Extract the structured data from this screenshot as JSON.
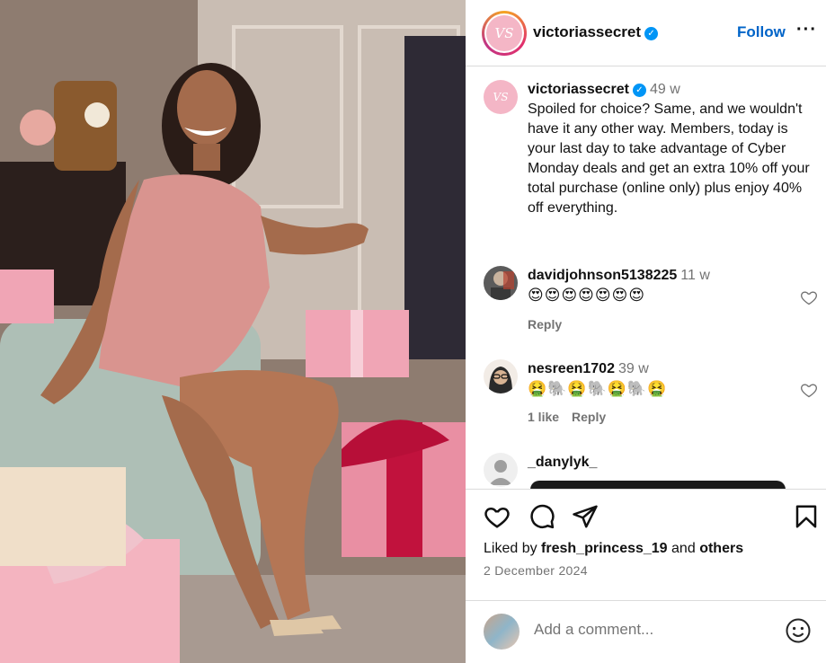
{
  "header": {
    "username": "victoriassecret",
    "follow_label": "Follow",
    "more_label": "···",
    "logo_text": "VS"
  },
  "caption": {
    "username": "victoriassecret",
    "time": "49 w",
    "text": "Spoiled for choice? Same, and we wouldn't have it any other way. Members, today is your last day to take advantage of Cyber Monday deals and get an extra 10% off your total purchase (online only) plus enjoy 40% off everything."
  },
  "comments": [
    {
      "username": "davidjohnson5138225",
      "time": "11 w",
      "text": "😍😍😍😍😍😍😍",
      "actions": [
        "Reply"
      ]
    },
    {
      "username": "nesreen1702",
      "time": "39 w",
      "text": "🤮🐘🤮🐘🤮🐘🤮",
      "actions": [
        "1 like",
        "Reply"
      ]
    },
    {
      "username": "_danylyk_",
      "time": "",
      "text": "",
      "actions": []
    }
  ],
  "likes": {
    "prefix": "Liked by",
    "user": "fresh_princess_19",
    "middle": "and",
    "suffix": "others"
  },
  "date": "2 December 2024",
  "add_comment": {
    "placeholder": "Add a comment..."
  },
  "icons": [
    "heart-icon",
    "comment-icon",
    "share-icon",
    "bookmark-icon",
    "emoji-icon"
  ],
  "colors": {
    "accent": "#0095f6",
    "follow": "#0064c8",
    "muted": "#737373",
    "border": "#dbdbdb",
    "brand_pink": "#f4b6c6"
  }
}
